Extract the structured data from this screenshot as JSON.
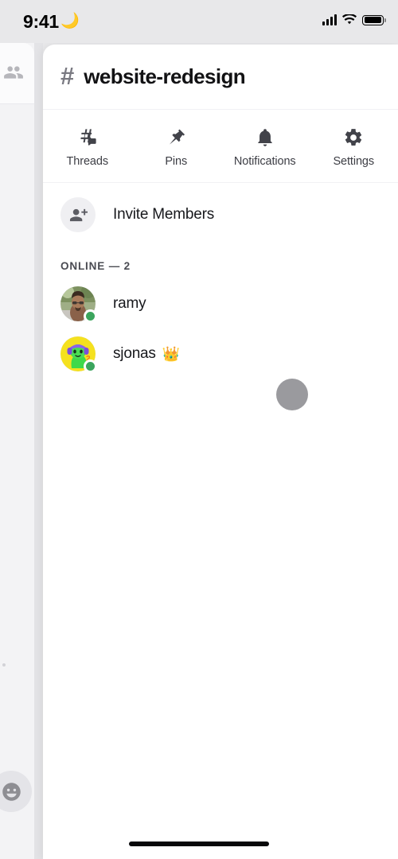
{
  "status_bar": {
    "time": "9:41",
    "dnd_icon": "crescent-moon-icon",
    "signal_icon": "cellular-signal-icon",
    "wifi_icon": "wifi-icon",
    "battery_icon": "battery-full-icon"
  },
  "background_panel": {
    "members_icon": "members-icon",
    "emoji_icon": "emoji-face-icon"
  },
  "header": {
    "hash": "#",
    "channel_name": "website-redesign"
  },
  "tabs": [
    {
      "label": "Threads",
      "icon": "threads-icon"
    },
    {
      "label": "Pins",
      "icon": "pin-icon"
    },
    {
      "label": "Notifications",
      "icon": "bell-icon"
    },
    {
      "label": "Settings",
      "icon": "gear-icon"
    }
  ],
  "invite": {
    "label": "Invite Members",
    "icon": "person-add-icon"
  },
  "section": {
    "online_header": "ONLINE — 2"
  },
  "members": [
    {
      "name": "ramy",
      "status": "online",
      "badge": "",
      "avatar_type": "photo"
    },
    {
      "name": "sjonas",
      "status": "online",
      "badge": "👑",
      "avatar_type": "illustration"
    }
  ],
  "overlay": {
    "tap_indicator": "tap-indicator"
  },
  "colors": {
    "online_green": "#3ba55d",
    "panel_white": "#ffffff",
    "screen_background": "#e8e8ea",
    "text_primary": "#17181c",
    "text_secondary": "#4a4b52",
    "tap_indicator_gray": "#9a9a9e"
  }
}
